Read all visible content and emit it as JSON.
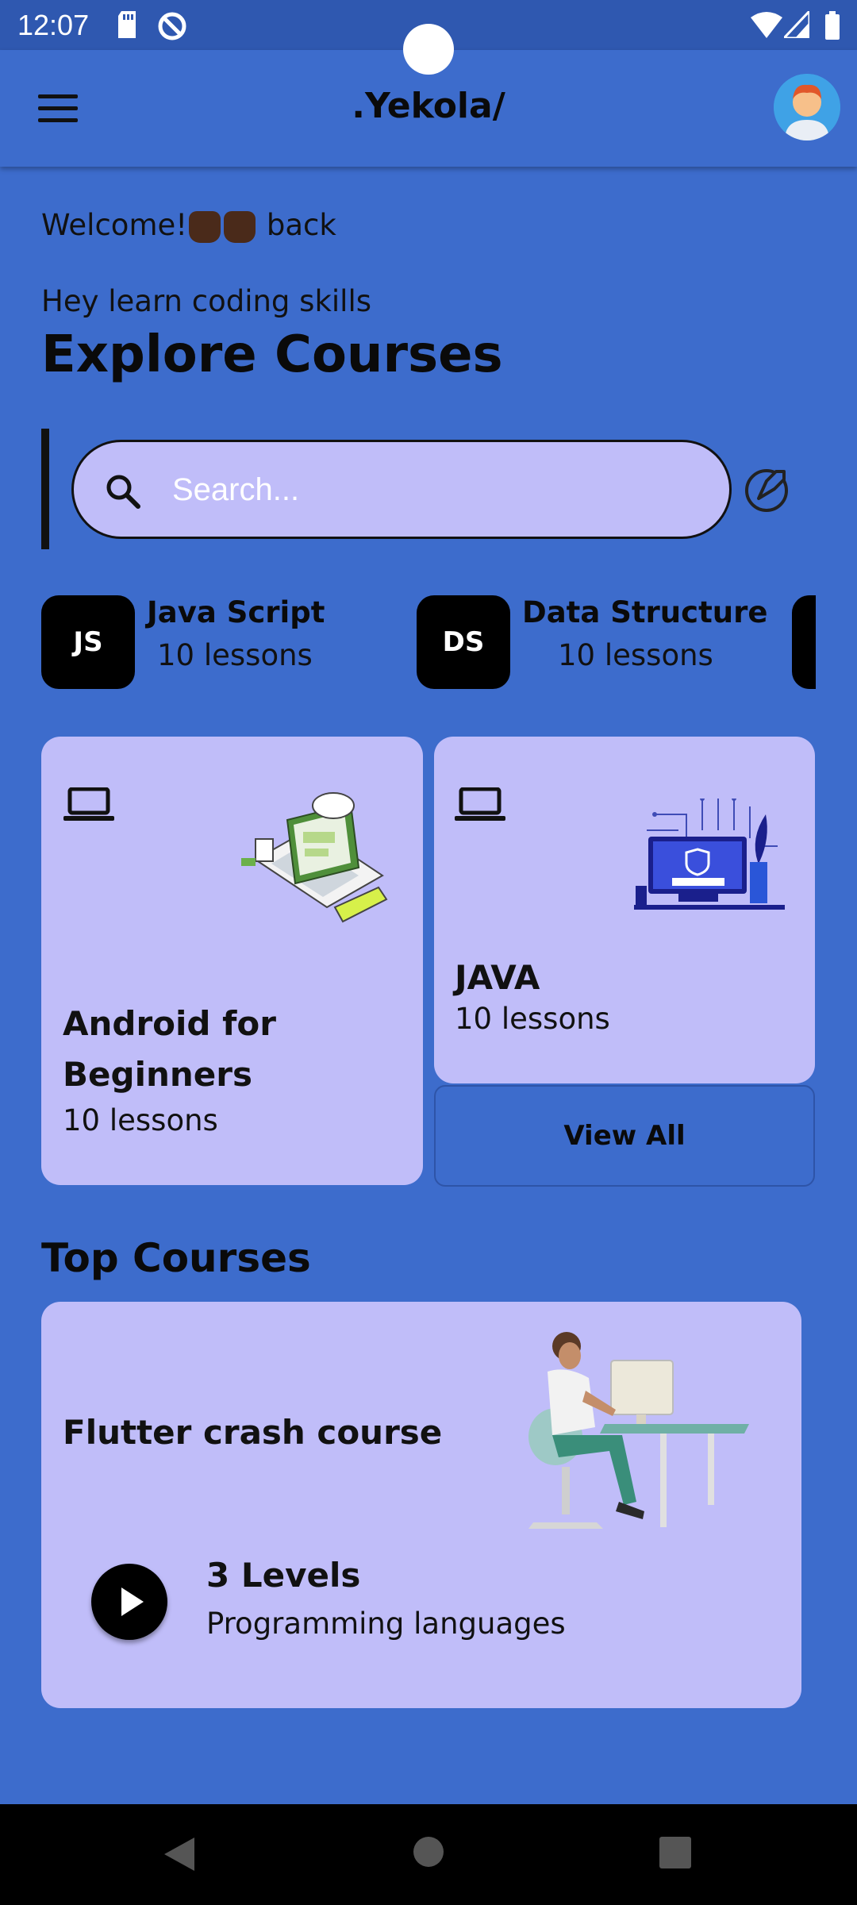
{
  "status_bar": {
    "time": "12:07"
  },
  "app_bar": {
    "title": ".Yekola/"
  },
  "welcome": {
    "prefix": "Welcome!",
    "suffix": "back"
  },
  "subtitle": "Hey learn coding skills",
  "headline": "Explore Courses",
  "search": {
    "placeholder": "Search..."
  },
  "chips": [
    {
      "badge": "JS",
      "title": "Java Script",
      "lessons": "10 lessons"
    },
    {
      "badge": "DS",
      "title": "Data Structure",
      "lessons": "10 lessons"
    }
  ],
  "cards": [
    {
      "title_line1": "Android for",
      "title_line2": "Beginners",
      "lessons": "10 lessons"
    },
    {
      "title": "JAVA",
      "lessons": "10 lessons"
    }
  ],
  "view_all_label": "View All",
  "top_courses": {
    "section_title": "Top Courses",
    "course": {
      "title": "Flutter crash course",
      "levels": "3 Levels",
      "category": "Programming languages"
    }
  },
  "colors": {
    "background": "#3d6ccc",
    "card": "#c0bdf9",
    "status_bar": "#2f58b0",
    "black": "#000000"
  }
}
